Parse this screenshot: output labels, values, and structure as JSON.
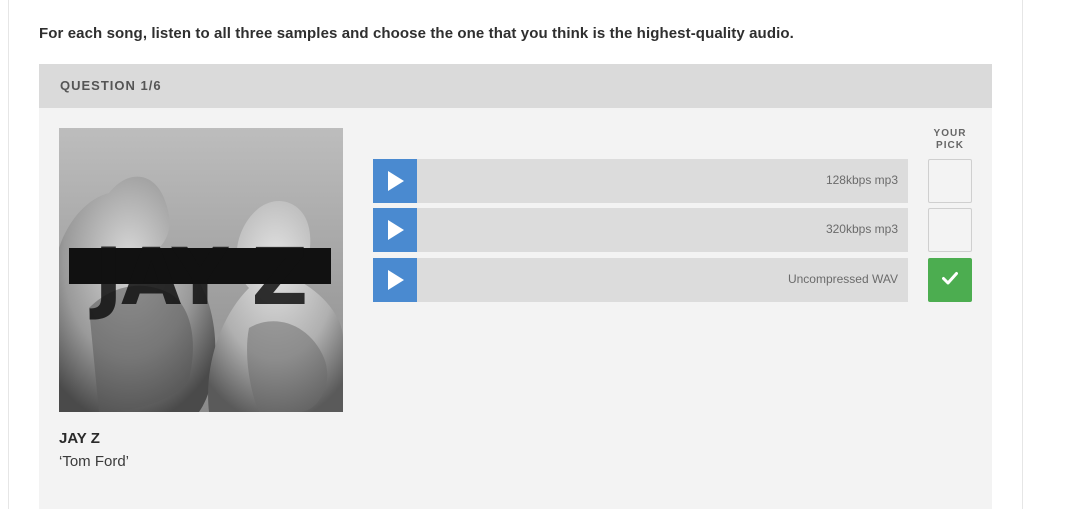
{
  "instructions": "For each song, listen to all three samples and choose the one that you think is the highest-quality audio.",
  "question": {
    "header": "QUESTION 1/6",
    "pick_header_line1": "YOUR",
    "pick_header_line2": "PICK",
    "album": {
      "art_text": "JAY Z",
      "artist": "JAY Z",
      "title": "‘Tom Ford’"
    },
    "samples": [
      {
        "label": "128kbps mp3",
        "selected": false,
        "icon": "play-icon"
      },
      {
        "label": "320kbps mp3",
        "selected": false,
        "icon": "play-icon"
      },
      {
        "label": "Uncompressed WAV",
        "selected": true,
        "icon": "play-icon"
      }
    ]
  },
  "colors": {
    "play_button": "#4a8ad0",
    "selected_pick": "#4cad50",
    "header_bg": "#dadada",
    "body_bg": "#f3f3f3"
  }
}
